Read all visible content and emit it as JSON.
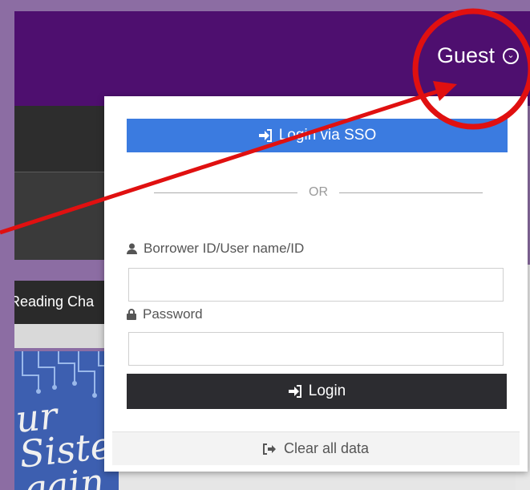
{
  "header": {
    "user_label": "Guest",
    "accent_color": "#4e0f6f"
  },
  "sidebar": {
    "reading_label": "Reading Cha",
    "book_title": "ur Siste gain"
  },
  "login": {
    "sso_label": "Login via SSO",
    "divider": "OR",
    "borrower_label": "Borrower ID/User name/ID",
    "borrower_value": "",
    "password_label": "Password",
    "password_value": "",
    "login_label": "Login",
    "clear_label": "Clear all data",
    "sso_color": "#3b7be0"
  },
  "annotation": {
    "color": "#e01010",
    "shapes": [
      "circle",
      "arrow"
    ]
  }
}
